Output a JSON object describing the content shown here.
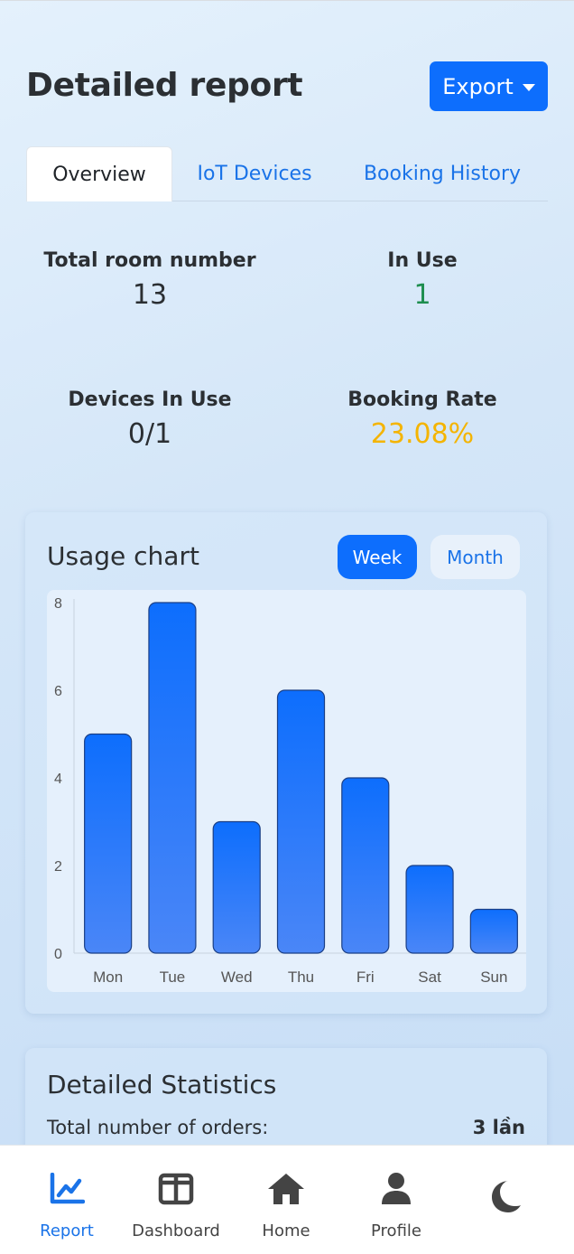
{
  "header": {
    "title": "Detailed report",
    "export_label": "Export"
  },
  "tabs": [
    {
      "label": "Overview",
      "active": true
    },
    {
      "label": "IoT Devices",
      "active": false
    },
    {
      "label": "Booking History",
      "active": false
    }
  ],
  "stats": [
    {
      "label": "Total room number",
      "value": "13",
      "color": "#2b2f33"
    },
    {
      "label": "In Use",
      "value": "1",
      "color": "#1e8e4f"
    },
    {
      "label": "Devices In Use",
      "value": "0/1",
      "color": "#2b2f33"
    },
    {
      "label": "Booking Rate",
      "value": "23.08%",
      "color": "#f4b400"
    }
  ],
  "usage_card": {
    "title": "Usage chart",
    "toggle": {
      "week_label": "Week",
      "month_label": "Month",
      "selected": "Week"
    }
  },
  "chart_data": {
    "type": "bar",
    "categories": [
      "Mon",
      "Tue",
      "Wed",
      "Thu",
      "Fri",
      "Sat",
      "Sun"
    ],
    "values": [
      5,
      8,
      3,
      6,
      4,
      2,
      1
    ],
    "title": "",
    "xlabel": "",
    "ylabel": "",
    "ylim": [
      0,
      8
    ],
    "yticks": [
      0,
      2,
      4,
      6,
      8
    ],
    "bar_color": "#1f75fe",
    "grid": false
  },
  "detailed_stats": {
    "title": "Detailed Statistics",
    "rows": [
      {
        "label": "Total number of orders:",
        "value": "3 lần"
      }
    ]
  },
  "bottom_nav": [
    {
      "label": "Report",
      "icon": "chart-line-icon",
      "active": true
    },
    {
      "label": "Dashboard",
      "icon": "dashboard-columns-icon",
      "active": false
    },
    {
      "label": "Home",
      "icon": "home-icon",
      "active": false
    },
    {
      "label": "Profile",
      "icon": "user-icon",
      "active": false
    },
    {
      "label": "",
      "icon": "moon-icon",
      "active": false
    }
  ],
  "colors": {
    "primary": "#0d6efd",
    "link": "#1a73e8",
    "success": "#1e8e4f",
    "warning": "#f4b400"
  }
}
